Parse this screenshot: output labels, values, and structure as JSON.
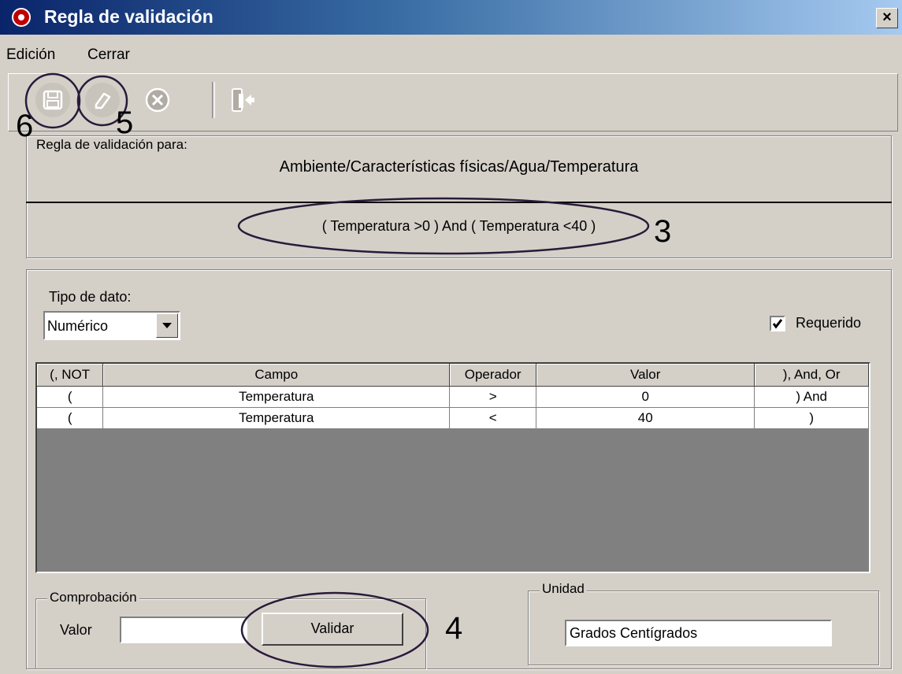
{
  "window": {
    "title": "Regla de validación",
    "close_label": "×"
  },
  "menu": {
    "items": [
      "Edición",
      "Cerrar"
    ]
  },
  "toolbar": {
    "icons": [
      "save-icon",
      "eraser-icon",
      "cancel-icon",
      "exit-icon"
    ]
  },
  "rule": {
    "caption": "Regla de validación para:",
    "path": "Ambiente/Características físicas/Agua/Temperatura",
    "expression": "( Temperatura >0  ) And ( Temperatura <40  )"
  },
  "datatype": {
    "label": "Tipo de dato:",
    "value": "Numérico"
  },
  "required": {
    "label": "Requerido",
    "checked": true
  },
  "grid": {
    "headers": [
      "(, NOT",
      "Campo",
      "Operador",
      "Valor",
      "), And, Or"
    ],
    "rows": [
      [
        "(",
        "Temperatura",
        ">",
        "0",
        ") And"
      ],
      [
        "(",
        "Temperatura",
        "<",
        "40",
        ")"
      ]
    ]
  },
  "check": {
    "caption": "Comprobación",
    "value_label": "Valor",
    "value": "",
    "button": "Validar"
  },
  "unit": {
    "caption": "Unidad",
    "value": "Grados Centígrados"
  },
  "annotations": {
    "a3": "3",
    "a4": "4",
    "a5": "5",
    "a6": "6"
  }
}
